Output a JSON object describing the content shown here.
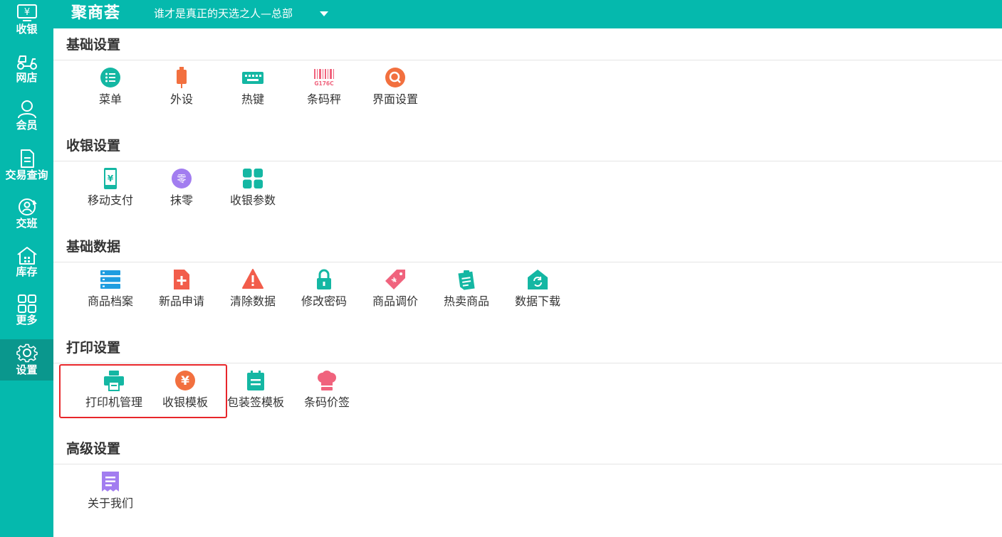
{
  "sidebar": {
    "items": [
      {
        "label": "收银",
        "icon": "cashier-icon"
      },
      {
        "label": "网店",
        "icon": "delivery-scooter-icon"
      },
      {
        "label": "会员",
        "icon": "member-icon"
      },
      {
        "label": "交易查询",
        "icon": "document-icon"
      },
      {
        "label": "交班",
        "icon": "shift-icon"
      },
      {
        "label": "库存",
        "icon": "warehouse-icon"
      },
      {
        "label": "更多",
        "icon": "grid-icon"
      },
      {
        "label": "设置",
        "icon": "gear-icon"
      }
    ],
    "active": "设置"
  },
  "header": {
    "logo": "聚商荟",
    "store": "谁才是真正的天选之人—总部"
  },
  "sections": [
    {
      "title": "基础设置",
      "items": [
        {
          "label": "菜单",
          "icon": "menu-list-icon"
        },
        {
          "label": "外设",
          "icon": "peripheral-icon"
        },
        {
          "label": "热键",
          "icon": "keyboard-icon"
        },
        {
          "label": "条码秤",
          "icon": "barcode-icon",
          "icon_text": "G176C"
        },
        {
          "label": "界面设置",
          "icon": "interface-search-icon"
        }
      ]
    },
    {
      "title": "收银设置",
      "items": [
        {
          "label": "移动支付",
          "icon": "mobile-pay-icon"
        },
        {
          "label": "抹零",
          "icon": "round-off-icon",
          "icon_text": "零"
        },
        {
          "label": "收银参数",
          "icon": "parameters-icon"
        }
      ]
    },
    {
      "title": "基础数据",
      "items": [
        {
          "label": "商品档案",
          "icon": "product-archive-icon"
        },
        {
          "label": "新品申请",
          "icon": "new-product-icon"
        },
        {
          "label": "清除数据",
          "icon": "warning-icon"
        },
        {
          "label": "修改密码",
          "icon": "lock-icon"
        },
        {
          "label": "商品调价",
          "icon": "price-tag-icon"
        },
        {
          "label": "热卖商品",
          "icon": "hot-sale-icon"
        },
        {
          "label": "数据下载",
          "icon": "data-download-icon"
        }
      ]
    },
    {
      "title": "打印设置",
      "items": [
        {
          "label": "打印机管理",
          "icon": "printer-icon"
        },
        {
          "label": "收银模板",
          "icon": "yuan-icon"
        },
        {
          "label": "包装签模板",
          "icon": "calendar-icon"
        },
        {
          "label": "条码价签",
          "icon": "chef-hat-icon"
        }
      ]
    },
    {
      "title": "高级设置",
      "items": [
        {
          "label": "关于我们",
          "icon": "about-icon"
        }
      ]
    }
  ],
  "highlight": {
    "section": "打印设置",
    "items": [
      "打印机管理",
      "收银模板"
    ],
    "color": "#e8262a"
  },
  "colors": {
    "brand": "#05b9ad",
    "sidebar_active": "#0a978d",
    "teal_icon": "#14b7a3",
    "orange": "#f2703f",
    "red": "#f25d4b",
    "pink": "#f0637d",
    "purple": "#a27df0",
    "text": "#333333"
  }
}
